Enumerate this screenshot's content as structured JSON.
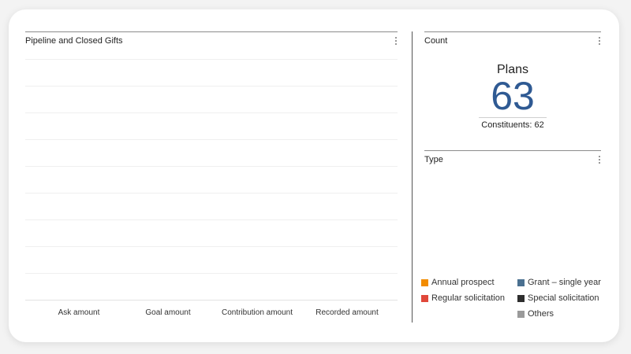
{
  "pipeline": {
    "title": "Pipeline and Closed Gifts",
    "x_labels": [
      "Ask amount",
      "Goal amount",
      "Contribution amount",
      "Recorded amount"
    ]
  },
  "count": {
    "title": "Count",
    "label": "Plans",
    "value": "63",
    "constituents": "Constituents: 62"
  },
  "type": {
    "title": "Type",
    "legend": [
      {
        "label": "Annual prospect",
        "color": "#f28c00"
      },
      {
        "label": "Grant – single year",
        "color": "#4a7090"
      },
      {
        "label": "Regular solicitation",
        "color": "#e0483a"
      },
      {
        "label": "Special solicitation",
        "color": "#2e2e2e"
      },
      {
        "label": "Others",
        "color": "#9a9a9a"
      }
    ]
  },
  "colors": {
    "accent": "#2f5a93"
  }
}
